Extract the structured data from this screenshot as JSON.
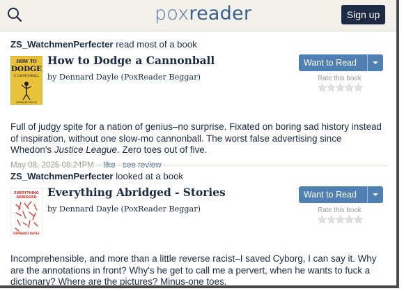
{
  "header": {
    "logo_lite": "pox",
    "logo_bold": "reader",
    "signup_label": "Sign up"
  },
  "colors": {
    "header_bg": "#f4f1ea",
    "signup_bg": "#1c2a44",
    "want_to_read_bg": "#4f7fb3",
    "link": "#38608c"
  },
  "items": [
    {
      "actor": "ZS_WatchmenPerfecter",
      "action": " read most of a book",
      "book": {
        "title": "How to Dodge a Cannonball",
        "by": "by ",
        "author": "Dennard Dayle",
        "author_note": " (PoxReader Beggar)",
        "cover_text_1": "HOW TO",
        "cover_text_2": "DODGE",
        "cover_text_3": "A CANNONBALL",
        "cover_text_4": "DENNARD DAYLE"
      },
      "want_to_read": "Want to Read",
      "rate_label": "Rate this book",
      "review_1": "Full of judgy spite for a nation of genius–no surprise. Fixated on boring sad history instead of inspiration, without one slow-mo cannonball. The worst false advertising since Whedon's ",
      "review_italic": "Justice League",
      "review_2": ". Zero toes out of five.",
      "date": "May 08, 2025 08:24PM",
      "like": "like",
      "see_review": "see review"
    },
    {
      "actor": "ZS_WatchmenPerfecter",
      "action": " looked at a book",
      "book": {
        "title": "Everything Abridged - Stories",
        "by": "by ",
        "author": "Dennard Dayle",
        "author_note": " (PoxReader Beggar)",
        "cover_text_1": "EVERYTHING",
        "cover_text_2": "ABRIDGED",
        "cover_text_3": "DENNARD DAYLE"
      },
      "want_to_read": "Want to Read",
      "rate_label": "Rate this book",
      "review_1": "Incomprehensible, and more than a little reverse racist–I saved Cyborg, I can say it. Why are the annotations in front? Why's he get to call me a pervert, when he wants to fuck a dictionary? Where are the pictures? Minus-one toes."
    }
  ]
}
